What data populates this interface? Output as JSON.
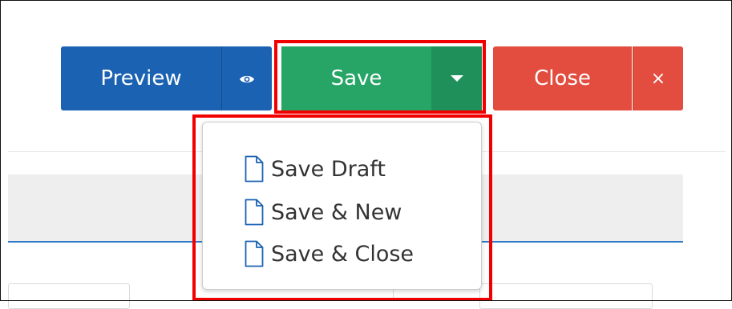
{
  "toolbar": {
    "preview_label": "Preview",
    "save_label": "Save",
    "close_label": "Close",
    "close_x_glyph": "×"
  },
  "save_menu": {
    "items": [
      {
        "label": "Save Draft",
        "icon": "file-icon"
      },
      {
        "label": "Save & New",
        "icon": "file-icon"
      },
      {
        "label": "Save & Close",
        "icon": "file-icon"
      }
    ]
  },
  "colors": {
    "preview": "#1b62b3",
    "save": "#27a567",
    "close": "#e34d3f",
    "highlight": "#f20000"
  }
}
